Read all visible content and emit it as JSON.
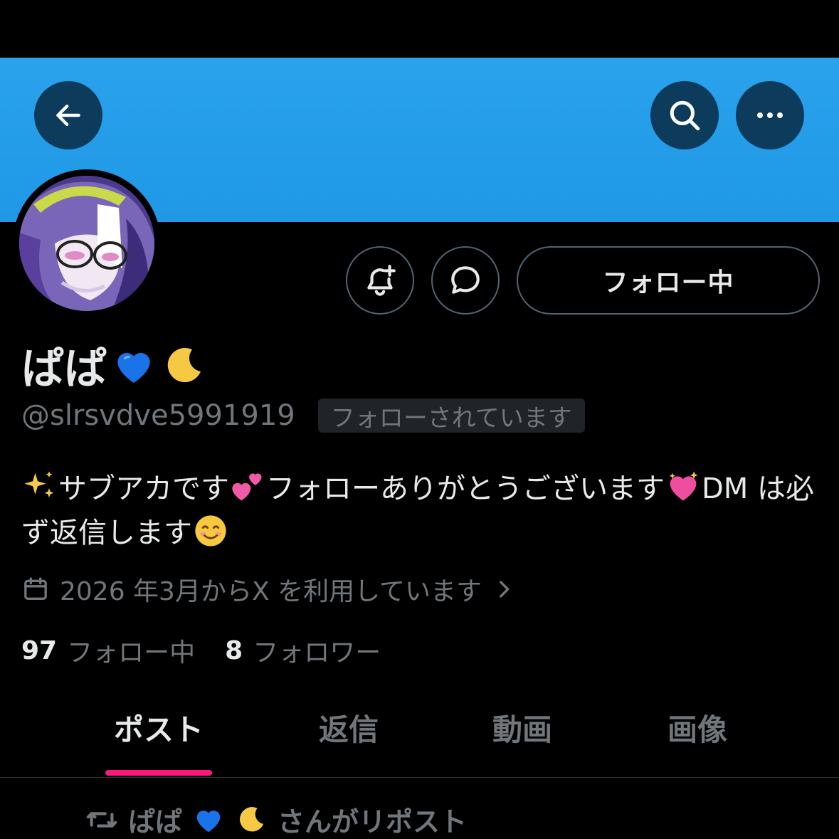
{
  "colors": {
    "banner": "#1d9bf0",
    "accent_underline": "#f91880",
    "text_primary": "#e7e9ea",
    "text_secondary": "#71767b",
    "border": "#536471"
  },
  "header": {
    "back_icon": "arrow-left-icon",
    "search_icon": "search-icon",
    "more_icon": "more-horizontal-icon"
  },
  "profile": {
    "display_name": "ぱぱ",
    "name_emojis": [
      "blue-heart-icon",
      "crescent-moon-icon"
    ],
    "handle": "@slrsvdve5991919",
    "follows_you_badge": "フォローされています",
    "bio_parts": {
      "p1": "サブアカです",
      "p2": "フォローありがとうございます",
      "p3": "DM は必ず返信します"
    },
    "bio_emojis": [
      "sparkles-icon",
      "two-hearts-icon",
      "sparkling-heart-icon",
      "smiling-face-icon"
    ],
    "joined": "2026 年3月からX を利用しています",
    "following_count": "97",
    "following_label": "フォロー中",
    "followers_count": "8",
    "followers_label": "フォロワー"
  },
  "actions": {
    "notify_icon": "bell-plus-icon",
    "message_icon": "message-bubble-icon",
    "following_button": "フォロー中"
  },
  "tabs": [
    {
      "label": "ポスト",
      "active": true
    },
    {
      "label": "返信",
      "active": false
    },
    {
      "label": "動画",
      "active": false
    },
    {
      "label": "画像",
      "active": false
    }
  ],
  "feed": {
    "repost_icon": "repost-icon",
    "repost_name": "ぱぱ",
    "repost_suffix": "さんがリポスト"
  }
}
